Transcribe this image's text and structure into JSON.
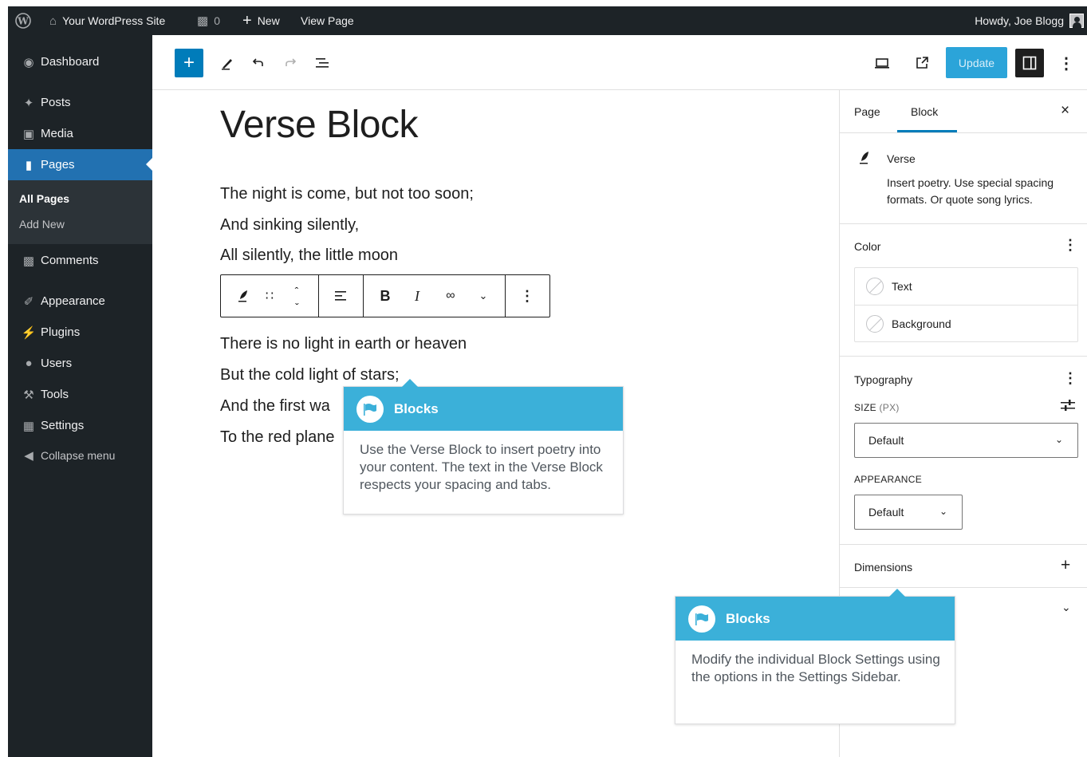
{
  "adminbar": {
    "site_name": "Your WordPress Site",
    "comments_count": "0",
    "new_label": "New",
    "view_page": "View Page",
    "howdy": "Howdy, Joe Blogg"
  },
  "menu": {
    "dashboard": "Dashboard",
    "posts": "Posts",
    "media": "Media",
    "pages": "Pages",
    "all_pages": "All Pages",
    "add_new": "Add New",
    "comments": "Comments",
    "appearance": "Appearance",
    "plugins": "Plugins",
    "users": "Users",
    "tools": "Tools",
    "settings": "Settings",
    "collapse": "Collapse menu"
  },
  "toolbar": {
    "update_label": "Update"
  },
  "editor": {
    "title": "Verse Block",
    "verse_lines_1": [
      "The night is come, but not too soon;",
      "And sinking silently,",
      "All silently, the little moon"
    ],
    "verse_lines_2": [
      "There is no light in earth or heaven",
      "But the cold light of stars;",
      "And the first wa",
      "To the red plane"
    ]
  },
  "sidebar": {
    "tab_page": "Page",
    "tab_block": "Block",
    "block_name": "Verse",
    "block_desc": "Insert poetry. Use special spacing formats. Or quote song lyrics.",
    "color_heading": "Color",
    "color_text": "Text",
    "color_background": "Background",
    "typography_heading": "Typography",
    "size_label": "SIZE",
    "size_unit": "(PX)",
    "size_value": "Default",
    "appearance_label": "APPEARANCE",
    "appearance_value": "Default",
    "dimensions_heading": "Dimensions"
  },
  "tooltips": [
    {
      "title": "Blocks",
      "body": "Use the Verse Block to insert poetry into your content. The text in the Verse Block respects your spacing and tabs."
    },
    {
      "title": "Blocks",
      "body": "Modify the individual Block Settings using the options in the Settings Sidebar."
    }
  ],
  "colors": {
    "admin_dark": "#1d2327",
    "admin_accent": "#2271b1",
    "editor_blue": "#007cba",
    "tooltip_blue": "#3bb0d9"
  }
}
